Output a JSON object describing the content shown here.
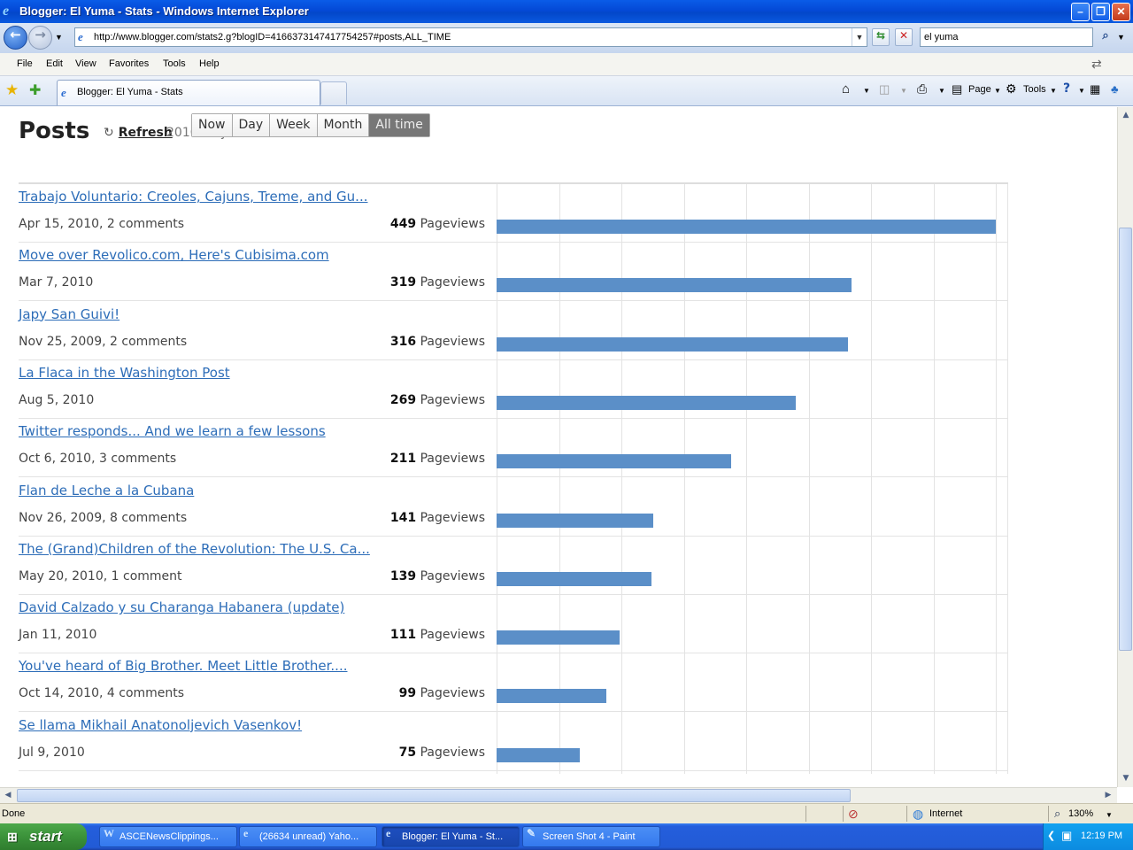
{
  "window": {
    "title": "Blogger: El Yuma - Stats - Windows Internet Explorer",
    "minimize": "–",
    "maximize": "❐",
    "close": "✕"
  },
  "address_bar": {
    "url": "http://www.blogger.com/stats2.g?blogID=4166373147417754257#posts,ALL_TIME",
    "search_value": "el yuma"
  },
  "menu": {
    "items": [
      "File",
      "Edit",
      "View",
      "Favorites",
      "Tools",
      "Help"
    ]
  },
  "tabs": {
    "active_tab": "Blogger: El Yuma - Stats"
  },
  "command_bar": {
    "page_label": "Page",
    "tools_label": "Tools"
  },
  "stats": {
    "title": "Posts",
    "refresh_label": "Refresh",
    "date_range": "2010 May - 2010 October",
    "periods": [
      "Now",
      "Day",
      "Week",
      "Month",
      "All time"
    ],
    "active_period": "All time",
    "pageviews_unit": "Pageviews",
    "axis_max": 449,
    "posts": [
      {
        "title": "Trabajo Voluntario: Creoles, Cajuns, Treme, and Gu...",
        "meta": "Apr 15, 2010, 2 comments",
        "pageviews": 449
      },
      {
        "title": "Move over Revolico.com, Here's Cubisima.com",
        "meta": "Mar 7, 2010",
        "pageviews": 319
      },
      {
        "title": "Japy San Guivi!",
        "meta": "Nov 25, 2009, 2 comments",
        "pageviews": 316
      },
      {
        "title": "La Flaca in the Washington Post",
        "meta": "Aug 5, 2010",
        "pageviews": 269
      },
      {
        "title": "Twitter responds... And we learn a few lessons",
        "meta": "Oct 6, 2010, 3 comments",
        "pageviews": 211
      },
      {
        "title": "Flan de Leche a la Cubana",
        "meta": "Nov 26, 2009, 8 comments",
        "pageviews": 141
      },
      {
        "title": "The (Grand)Children of the Revolution: The U.S. Ca...",
        "meta": "May 20, 2010, 1 comment",
        "pageviews": 139
      },
      {
        "title": "David Calzado y su Charanga Habanera (update)",
        "meta": "Jan 11, 2010",
        "pageviews": 111
      },
      {
        "title": "You've heard of Big Brother.  Meet Little Brother....",
        "meta": "Oct 14, 2010, 4 comments",
        "pageviews": 99
      },
      {
        "title": "Se llama Mikhail Anatonoljevich Vasenkov!",
        "meta": "Jul 9, 2010",
        "pageviews": 75
      }
    ]
  },
  "status_bar": {
    "status": "Done",
    "zone": "Internet",
    "zoom": "130%"
  },
  "taskbar": {
    "start_label": "start",
    "tasks": [
      {
        "label": "ASCENewsClippings...",
        "active": false
      },
      {
        "label": "(26634 unread) Yaho...",
        "active": false
      },
      {
        "label": "Blogger: El Yuma - St...",
        "active": true
      },
      {
        "label": "Screen Shot 4 - Paint",
        "active": false
      }
    ],
    "clock": "12:19 PM"
  },
  "colors": {
    "bar": "#5b8fc8",
    "link": "#2d6db8",
    "titlebar": "#0449d6"
  }
}
